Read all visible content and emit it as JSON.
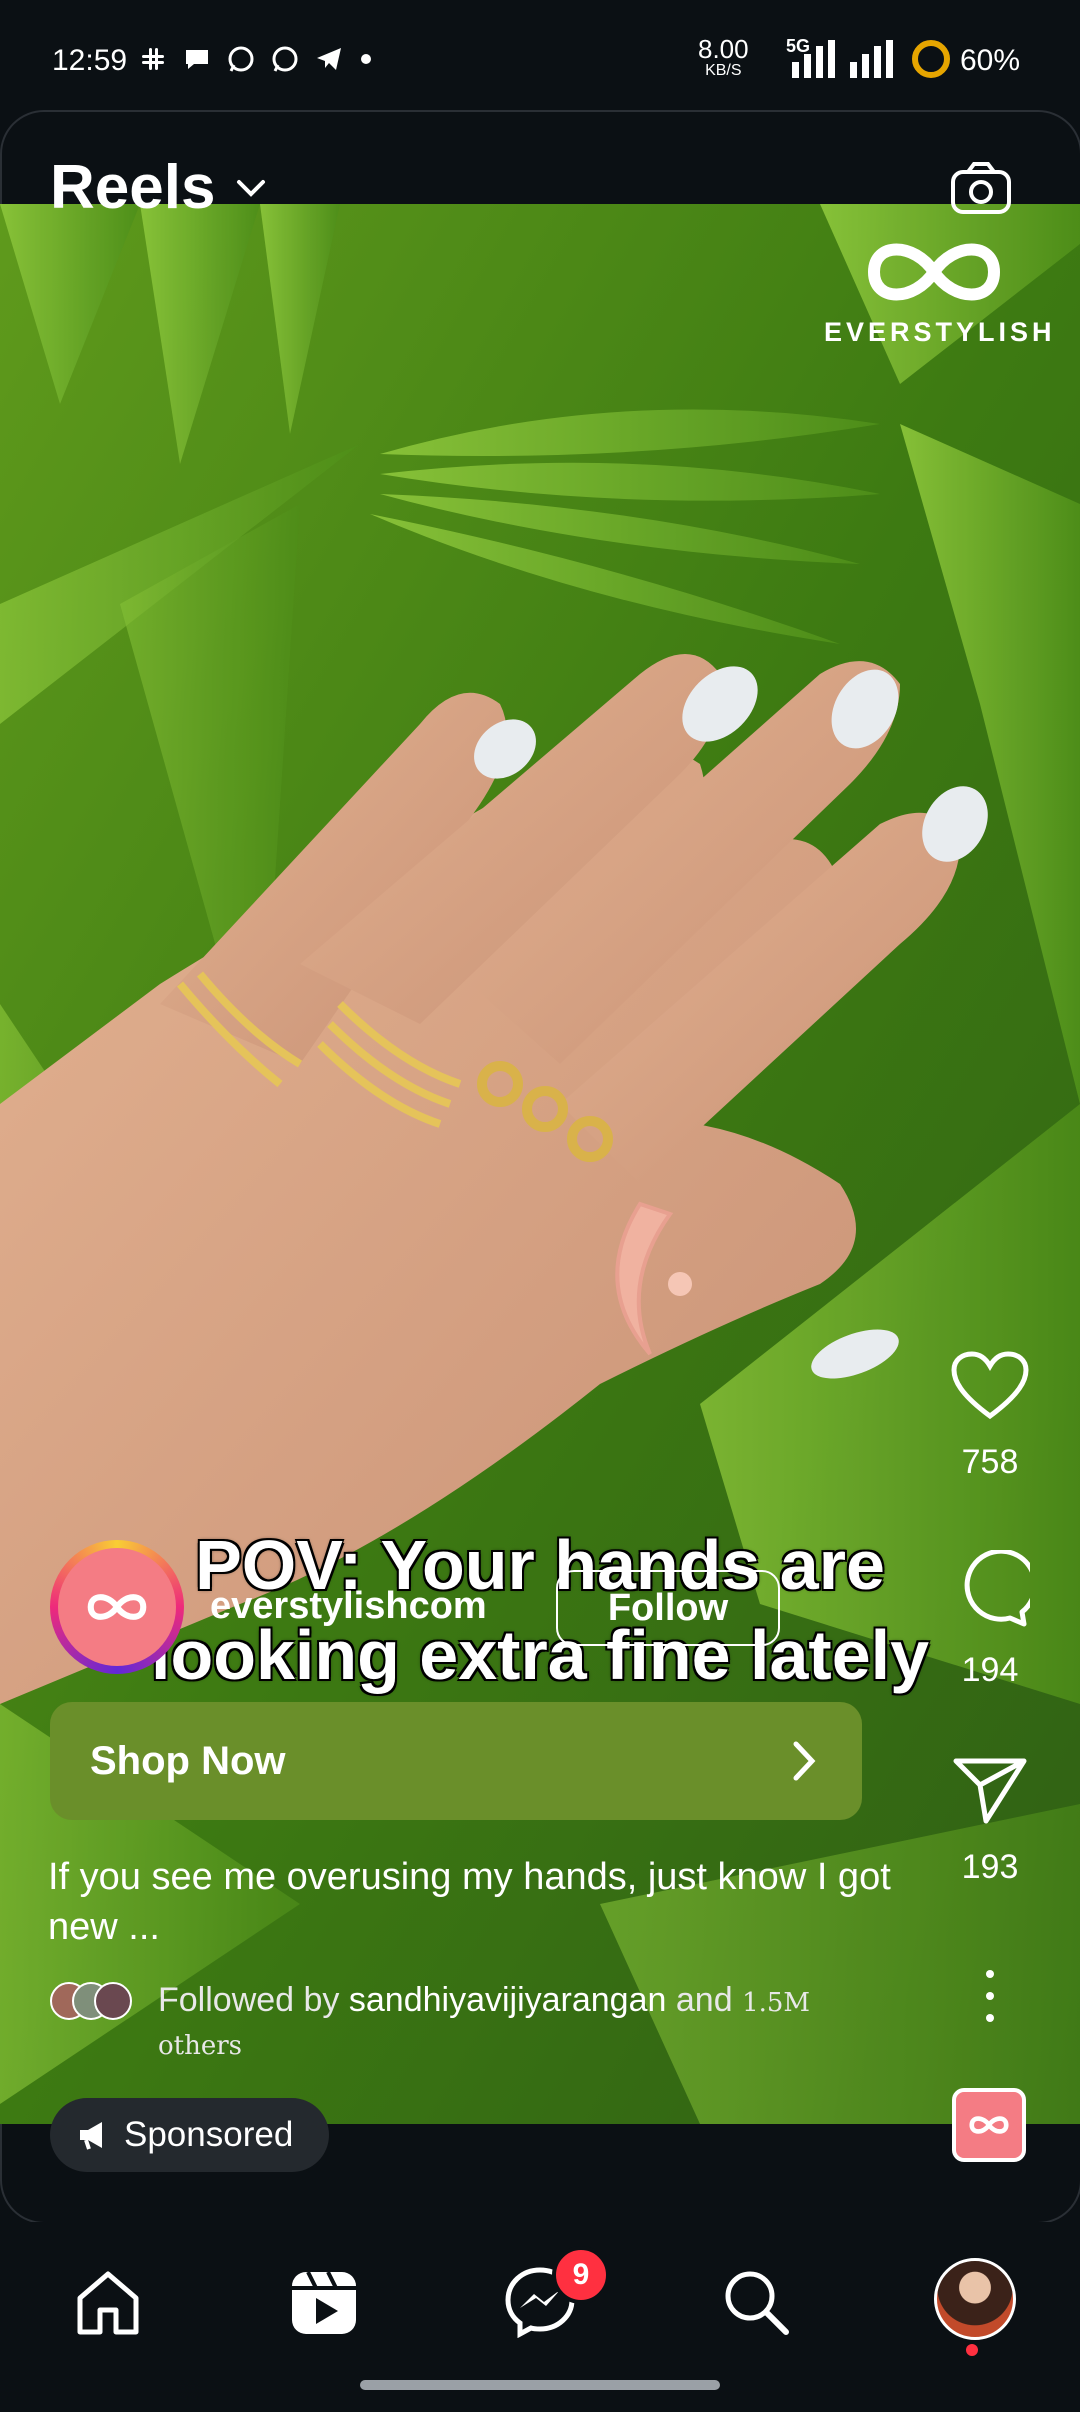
{
  "status_bar": {
    "time": "12:59",
    "net_speed": "8.00",
    "net_unit": "KB/S",
    "network": "5G",
    "battery": "60%"
  },
  "header": {
    "title": "Reels",
    "camera_icon": "camera-icon"
  },
  "brand": {
    "logo_icon": "infinity-logo",
    "name": "EVERSTYLISH"
  },
  "overlay_caption": "POV: Your hands are looking extra fine lately",
  "post": {
    "username": "everstylishcom",
    "follow_label": "Follow",
    "shop_button_label": "Shop Now",
    "description": "If you see me overusing my hands, just know I got new ...",
    "followed_by_prefix": "Followed by",
    "followed_by_name": "sandhiyavijiyarangan",
    "followed_by_and": "and",
    "followed_by_count": "1.5M",
    "followed_by_suffix": "others",
    "sponsored_label": "Sponsored"
  },
  "actions": {
    "likes": "758",
    "comments": "194",
    "shares": "193"
  },
  "bottom_nav": {
    "items": [
      "home-icon",
      "reels-icon",
      "messenger-icon",
      "search-icon",
      "profile-avatar"
    ],
    "messenger_badge": "9"
  },
  "colors": {
    "shop_button": "#6a8f2a",
    "badge": "#ff3040",
    "brand_pink": "#f47c84",
    "background": "#0b1014"
  }
}
